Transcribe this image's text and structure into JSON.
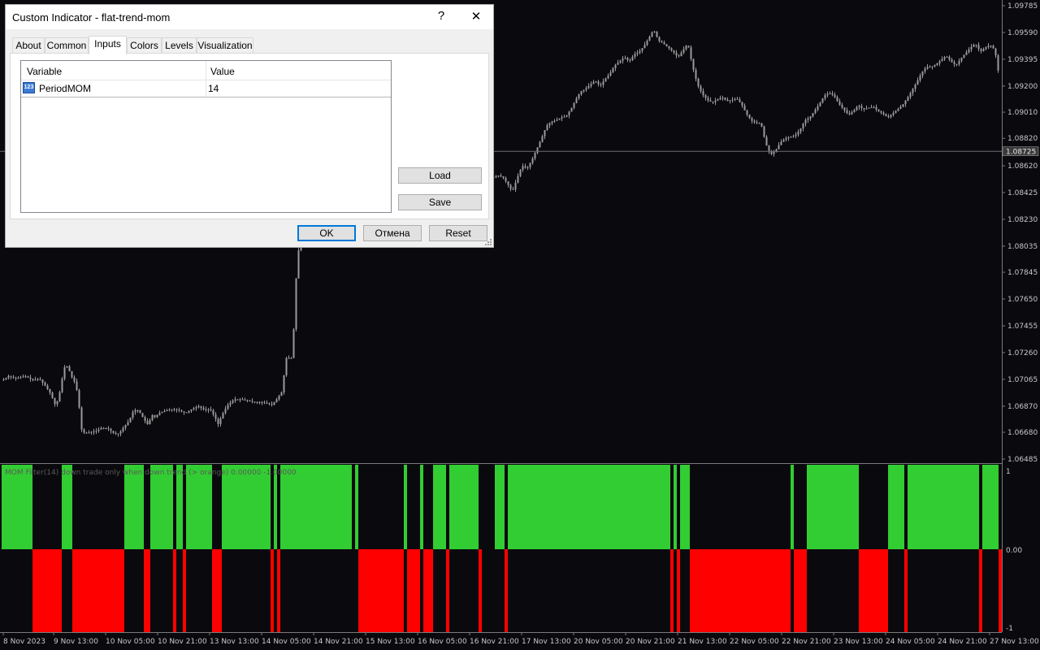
{
  "dialog": {
    "title": "Custom Indicator - flat-trend-mom",
    "help_glyph": "?",
    "close_glyph": "✕",
    "tabs": [
      {
        "label": "About",
        "active": false
      },
      {
        "label": "Common",
        "active": false
      },
      {
        "label": "Inputs",
        "active": true
      },
      {
        "label": "Colors",
        "active": false
      },
      {
        "label": "Levels",
        "active": false
      },
      {
        "label": "Visualization",
        "active": false
      }
    ],
    "grid": {
      "col_variable": "Variable",
      "col_value": "Value",
      "rows": [
        {
          "icon": "numeric-param-icon",
          "icon_text": "123",
          "variable": "PeriodMOM",
          "value": "14"
        }
      ]
    },
    "buttons": {
      "load": "Load",
      "save": "Save",
      "ok": "OK",
      "cancel": "Отмена",
      "reset": "Reset"
    }
  },
  "chart": {
    "price_ticks": [
      "1.09785",
      "1.09590",
      "1.09395",
      "1.09200",
      "1.09010",
      "1.08820",
      "1.08620",
      "1.08425",
      "1.08230",
      "1.08035",
      "1.07845",
      "1.07650",
      "1.07455",
      "1.07260",
      "1.07065",
      "1.06870",
      "1.06680",
      "1.06485"
    ],
    "current_price": "1.08725",
    "current_price_value": 1.08725,
    "indicator_label": "MOM Filter(14) down trade only when down trend (> orange) 0.00000 -1.00000",
    "indicator_scale": [
      "1",
      "0.00",
      "-1"
    ],
    "time_labels": [
      "8 Nov 2023",
      "9 Nov 13:00",
      "10 Nov 05:00",
      "10 Nov 21:00",
      "13 Nov 13:00",
      "14 Nov 05:00",
      "14 Nov 21:00",
      "15 Nov 13:00",
      "16 Nov 05:00",
      "16 Nov 21:00",
      "17 Nov 13:00",
      "20 Nov 05:00",
      "20 Nov 21:00",
      "21 Nov 13:00",
      "22 Nov 05:00",
      "22 Nov 21:00",
      "23 Nov 13:00",
      "24 Nov 05:00",
      "24 Nov 21:00",
      "27 Nov 13:00"
    ],
    "colors": {
      "background": "#0a0a0e",
      "candle": "#9a9a9a",
      "axis_text": "#c8c8c8",
      "up_histogram": "#32cd32",
      "down_histogram": "#ff0000"
    },
    "price_path": [
      [
        0,
        1.07065
      ],
      [
        5,
        1.07065
      ],
      [
        10,
        1.0709
      ],
      [
        20,
        1.0707
      ],
      [
        30,
        1.0709
      ],
      [
        40,
        1.0706
      ],
      [
        48,
        1.0707
      ],
      [
        55,
        1.0702
      ],
      [
        62,
        1.0696
      ],
      [
        68,
        1.0687
      ],
      [
        72,
        1.0694
      ],
      [
        76,
        1.0707
      ],
      [
        80,
        1.0718
      ],
      [
        84,
        1.0714
      ],
      [
        88,
        1.0708
      ],
      [
        93,
        1.0703
      ],
      [
        97,
        1.0686
      ],
      [
        100,
        1.067
      ],
      [
        104,
        1.0667
      ],
      [
        110,
        1.0668
      ],
      [
        118,
        1.0669
      ],
      [
        124,
        1.0671
      ],
      [
        132,
        1.0671
      ],
      [
        140,
        1.0667
      ],
      [
        146,
        1.0667
      ],
      [
        152,
        1.0672
      ],
      [
        158,
        1.0676
      ],
      [
        164,
        1.0684
      ],
      [
        170,
        1.0684
      ],
      [
        176,
        1.0678
      ],
      [
        182,
        1.0673
      ],
      [
        186,
        1.0681
      ],
      [
        190,
        1.0679
      ],
      [
        196,
        1.0682
      ],
      [
        204,
        1.0684
      ],
      [
        212,
        1.0685
      ],
      [
        220,
        1.0684
      ],
      [
        228,
        1.0682
      ],
      [
        236,
        1.0685
      ],
      [
        244,
        1.0687
      ],
      [
        252,
        1.0684
      ],
      [
        258,
        1.0685
      ],
      [
        264,
        1.0679
      ],
      [
        268,
        1.0674
      ],
      [
        274,
        1.0682
      ],
      [
        280,
        1.0688
      ],
      [
        288,
        1.0692
      ],
      [
        296,
        1.0692
      ],
      [
        304,
        1.0691
      ],
      [
        312,
        1.069
      ],
      [
        320,
        1.069
      ],
      [
        328,
        1.0689
      ],
      [
        334,
        1.0688
      ],
      [
        340,
        1.0692
      ],
      [
        346,
        1.0697
      ],
      [
        352,
        1.0722
      ],
      [
        358,
        1.0722
      ],
      [
        362,
        1.075
      ],
      [
        365,
        1.0795
      ],
      [
        368,
        1.0803
      ],
      [
        375,
        1.0811
      ],
      [
        385,
        1.0818
      ],
      [
        395,
        1.0823
      ],
      [
        405,
        1.0829
      ],
      [
        415,
        1.0832
      ],
      [
        425,
        1.0834
      ],
      [
        435,
        1.0838
      ],
      [
        445,
        1.0844
      ],
      [
        455,
        1.085
      ],
      [
        465,
        1.0856
      ],
      [
        475,
        1.0858
      ],
      [
        485,
        1.0855
      ],
      [
        495,
        1.0857
      ],
      [
        505,
        1.0854
      ],
      [
        515,
        1.0856
      ],
      [
        525,
        1.0855
      ],
      [
        535,
        1.0853
      ],
      [
        545,
        1.0856
      ],
      [
        555,
        1.0853
      ],
      [
        565,
        1.0855
      ],
      [
        575,
        1.0853
      ],
      [
        585,
        1.0854
      ],
      [
        595,
        1.0856
      ],
      [
        605,
        1.0853
      ],
      [
        612,
        1.0855
      ],
      [
        618,
        1.0854
      ],
      [
        624,
        1.0849
      ],
      [
        630,
        1.0843
      ],
      [
        636,
        1.0853
      ],
      [
        642,
        1.0862
      ],
      [
        648,
        1.086
      ],
      [
        654,
        1.0866
      ],
      [
        660,
        1.0874
      ],
      [
        666,
        1.0882
      ],
      [
        672,
        1.0891
      ],
      [
        678,
        1.0894
      ],
      [
        684,
        1.0895
      ],
      [
        690,
        1.0897
      ],
      [
        696,
        1.0898
      ],
      [
        702,
        1.0903
      ],
      [
        708,
        1.091
      ],
      [
        714,
        1.0916
      ],
      [
        720,
        1.0918
      ],
      [
        726,
        1.0921
      ],
      [
        732,
        1.0924
      ],
      [
        738,
        1.092
      ],
      [
        744,
        1.0925
      ],
      [
        750,
        1.0929
      ],
      [
        756,
        1.0935
      ],
      [
        762,
        1.0938
      ],
      [
        768,
        1.0941
      ],
      [
        774,
        1.0938
      ],
      [
        780,
        1.0943
      ],
      [
        786,
        1.0945
      ],
      [
        792,
        1.0949
      ],
      [
        798,
        1.0955
      ],
      [
        804,
        1.0961
      ],
      [
        810,
        1.0953
      ],
      [
        816,
        1.0951
      ],
      [
        822,
        1.0948
      ],
      [
        828,
        1.0945
      ],
      [
        834,
        1.0941
      ],
      [
        840,
        1.0946
      ],
      [
        846,
        1.0951
      ],
      [
        852,
        1.0934
      ],
      [
        858,
        1.0921
      ],
      [
        864,
        1.0914
      ],
      [
        870,
        1.091
      ],
      [
        876,
        1.0908
      ],
      [
        882,
        1.091
      ],
      [
        888,
        1.0912
      ],
      [
        894,
        1.0909
      ],
      [
        900,
        1.091
      ],
      [
        906,
        1.0911
      ],
      [
        912,
        1.0907
      ],
      [
        918,
        1.09
      ],
      [
        924,
        1.0895
      ],
      [
        930,
        1.0893
      ],
      [
        936,
        1.0893
      ],
      [
        942,
        1.0878
      ],
      [
        948,
        1.087
      ],
      [
        954,
        1.0873
      ],
      [
        960,
        1.0879
      ],
      [
        966,
        1.0882
      ],
      [
        972,
        1.0883
      ],
      [
        978,
        1.0884
      ],
      [
        984,
        1.0888
      ],
      [
        990,
        1.0895
      ],
      [
        996,
        1.0897
      ],
      [
        1002,
        1.0902
      ],
      [
        1008,
        1.0907
      ],
      [
        1014,
        1.0913
      ],
      [
        1020,
        1.0915
      ],
      [
        1026,
        1.0913
      ],
      [
        1032,
        1.0907
      ],
      [
        1038,
        1.0903
      ],
      [
        1044,
        1.0899
      ],
      [
        1050,
        1.0902
      ],
      [
        1056,
        1.0906
      ],
      [
        1062,
        1.0903
      ],
      [
        1068,
        1.0904
      ],
      [
        1074,
        1.0905
      ],
      [
        1080,
        1.0902
      ],
      [
        1086,
        1.09
      ],
      [
        1092,
        1.0897
      ],
      [
        1098,
        1.09
      ],
      [
        1104,
        1.0903
      ],
      [
        1110,
        1.0906
      ],
      [
        1116,
        1.0911
      ],
      [
        1122,
        1.0917
      ],
      [
        1128,
        1.0923
      ],
      [
        1134,
        1.093
      ],
      [
        1140,
        1.0934
      ],
      [
        1146,
        1.0934
      ],
      [
        1152,
        1.0936
      ],
      [
        1158,
        1.0939
      ],
      [
        1164,
        1.0942
      ],
      [
        1170,
        1.0938
      ],
      [
        1176,
        1.0935
      ],
      [
        1182,
        1.094
      ],
      [
        1188,
        1.0944
      ],
      [
        1194,
        1.0948
      ],
      [
        1200,
        1.0951
      ],
      [
        1206,
        1.0945
      ],
      [
        1212,
        1.0948
      ],
      [
        1218,
        1.095
      ],
      [
        1224,
        1.0946
      ],
      [
        1230,
        1.0924
      ]
    ],
    "histogram_segments": [
      {
        "start": 2,
        "end": 40,
        "dir": 1
      },
      {
        "start": 40,
        "end": 76,
        "dir": -1
      },
      {
        "start": 76,
        "end": 89,
        "dir": 1
      },
      {
        "start": 89,
        "end": 153,
        "dir": -1
      },
      {
        "start": 153,
        "end": 177,
        "dir": 1
      },
      {
        "start": 177,
        "end": 185,
        "dir": -1
      },
      {
        "start": 185,
        "end": 213,
        "dir": 1
      },
      {
        "start": 213,
        "end": 217,
        "dir": -1
      },
      {
        "start": 217,
        "end": 225,
        "dir": 1
      },
      {
        "start": 225,
        "end": 229,
        "dir": -1
      },
      {
        "start": 229,
        "end": 261,
        "dir": 1
      },
      {
        "start": 261,
        "end": 273,
        "dir": -1
      },
      {
        "start": 273,
        "end": 333,
        "dir": 1
      },
      {
        "start": 333,
        "end": 337,
        "dir": -1
      },
      {
        "start": 337,
        "end": 341,
        "dir": 1
      },
      {
        "start": 341,
        "end": 345,
        "dir": -1
      },
      {
        "start": 345,
        "end": 433,
        "dir": 1
      },
      {
        "start": 433,
        "end": 437,
        "dir": 0
      },
      {
        "start": 437,
        "end": 441,
        "dir": 1
      },
      {
        "start": 441,
        "end": 497,
        "dir": -1
      },
      {
        "start": 497,
        "end": 501,
        "dir": 1
      },
      {
        "start": 501,
        "end": 517,
        "dir": -1
      },
      {
        "start": 517,
        "end": 521,
        "dir": 1
      },
      {
        "start": 521,
        "end": 533,
        "dir": -1
      },
      {
        "start": 533,
        "end": 549,
        "dir": 1
      },
      {
        "start": 549,
        "end": 553,
        "dir": -1
      },
      {
        "start": 553,
        "end": 589,
        "dir": 1
      },
      {
        "start": 589,
        "end": 593,
        "dir": -1
      },
      {
        "start": 593,
        "end": 609,
        "dir": 0
      },
      {
        "start": 609,
        "end": 621,
        "dir": 1
      },
      {
        "start": 621,
        "end": 625,
        "dir": -1
      },
      {
        "start": 625,
        "end": 637,
        "dir": 1
      },
      {
        "start": 637,
        "end": 825,
        "dir": 1
      },
      {
        "start": 825,
        "end": 829,
        "dir": -1
      },
      {
        "start": 829,
        "end": 833,
        "dir": 1
      },
      {
        "start": 833,
        "end": 837,
        "dir": -1
      },
      {
        "start": 837,
        "end": 849,
        "dir": 1
      },
      {
        "start": 849,
        "end": 973,
        "dir": -1
      },
      {
        "start": 973,
        "end": 977,
        "dir": 1
      },
      {
        "start": 977,
        "end": 993,
        "dir": -1
      },
      {
        "start": 993,
        "end": 1057,
        "dir": 1
      },
      {
        "start": 1057,
        "end": 1093,
        "dir": -1
      },
      {
        "start": 1093,
        "end": 1113,
        "dir": 1
      },
      {
        "start": 1113,
        "end": 1117,
        "dir": -1
      },
      {
        "start": 1117,
        "end": 1205,
        "dir": 1
      },
      {
        "start": 1205,
        "end": 1209,
        "dir": -1
      },
      {
        "start": 1209,
        "end": 1229,
        "dir": 1
      },
      {
        "start": 1229,
        "end": 1233,
        "dir": -1
      }
    ]
  }
}
